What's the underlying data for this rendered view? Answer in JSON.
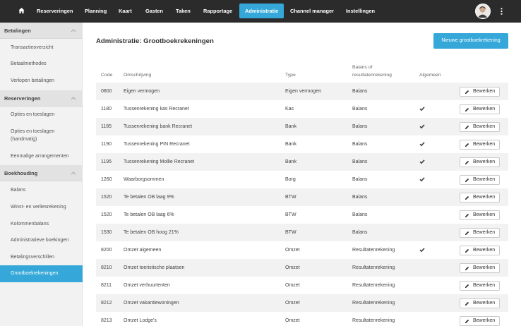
{
  "nav": {
    "items": [
      {
        "label": "Reserveringen"
      },
      {
        "label": "Planning"
      },
      {
        "label": "Kaart"
      },
      {
        "label": "Gasten"
      },
      {
        "label": "Taken"
      },
      {
        "label": "Rapportage"
      },
      {
        "label": "Administratie"
      },
      {
        "label": "Channel manager"
      },
      {
        "label": "Instellingen"
      }
    ],
    "active": "Administratie",
    "home_icon": "home-icon",
    "menu_icon": "kebab-menu-icon"
  },
  "sidebar": {
    "groups": [
      {
        "title": "Betalingen",
        "items": [
          {
            "label": "Transactieoverzicht"
          },
          {
            "label": "Betaalmethodes"
          },
          {
            "label": "Verlopen betalingen"
          }
        ]
      },
      {
        "title": "Reserveringen",
        "items": [
          {
            "label": "Opties en toeslagen"
          },
          {
            "label": "Opties en toeslagen (handmatig)"
          },
          {
            "label": "Eenmalige arrangementen"
          }
        ]
      },
      {
        "title": "Boekhouding",
        "items": [
          {
            "label": "Balans"
          },
          {
            "label": "Winst- en verliesrekening"
          },
          {
            "label": "Kolommenbalans"
          },
          {
            "label": "Administratieve boekingen"
          },
          {
            "label": "Betalingsverschillen"
          },
          {
            "label": "Grootboekrekeningen"
          }
        ]
      }
    ],
    "active_item": "Grootboekrekeningen"
  },
  "main": {
    "title": "Administratie: Grootboekrekeningen",
    "new_button": "Nieuwe grootboekrekening",
    "columns": {
      "code": "Code",
      "description": "Omschrijving",
      "type": "Type",
      "balance_line1": "Balans of",
      "balance_line2": "resultatenrekening",
      "general": "Algemeen"
    },
    "edit_label": "Bewerken",
    "rows": [
      {
        "code": "0800",
        "description": "Eigen vermogen",
        "type": "Eigen vermogen",
        "balance": "Balans",
        "general": false
      },
      {
        "code": "1180",
        "description": "Tussenrekening kas Recranet",
        "type": "Kas",
        "balance": "Balans",
        "general": true
      },
      {
        "code": "1185",
        "description": "Tussenrekening bank Recranet",
        "type": "Bank",
        "balance": "Balans",
        "general": true
      },
      {
        "code": "1190",
        "description": "Tussenrekening PIN Recranet",
        "type": "Bank",
        "balance": "Balans",
        "general": true
      },
      {
        "code": "1195",
        "description": "Tussenrekening Mollie Recranet",
        "type": "Bank",
        "balance": "Balans",
        "general": true
      },
      {
        "code": "1260",
        "description": "Waarborgsommen",
        "type": "Borg",
        "balance": "Balans",
        "general": true
      },
      {
        "code": "1520",
        "description": "Te betalen OB laag 9%",
        "type": "BTW",
        "balance": "Balans",
        "general": false
      },
      {
        "code": "1520",
        "description": "Te betalen OB laag 6%",
        "type": "BTW",
        "balance": "Balans",
        "general": false
      },
      {
        "code": "1530",
        "description": "Te betalen OB hoog 21%",
        "type": "BTW",
        "balance": "Balans",
        "general": false
      },
      {
        "code": "8200",
        "description": "Omzet algemeen",
        "type": "Omzet",
        "balance": "Resultatenrekening",
        "general": true
      },
      {
        "code": "8210",
        "description": "Omzet toeristische plaatsen",
        "type": "Omzet",
        "balance": "Resultatenrekening",
        "general": false
      },
      {
        "code": "8211",
        "description": "Omzet verhuurtenten",
        "type": "Omzet",
        "balance": "Resultatenrekening",
        "general": false
      },
      {
        "code": "8212",
        "description": "Omzet vakantiewoningen",
        "type": "Omzet",
        "balance": "Resultatenrekening",
        "general": false
      },
      {
        "code": "8213",
        "description": "Omzet Lodge's",
        "type": "Omzet",
        "balance": "Resultatenrekening",
        "general": false
      }
    ]
  },
  "colors": {
    "accent": "#35a8d9",
    "topbar": "#2b2b2b",
    "sidebar_bg": "#f2f2f2",
    "sidebar_header": "#e2e2e2",
    "row_stripe": "#f2f2f2"
  }
}
